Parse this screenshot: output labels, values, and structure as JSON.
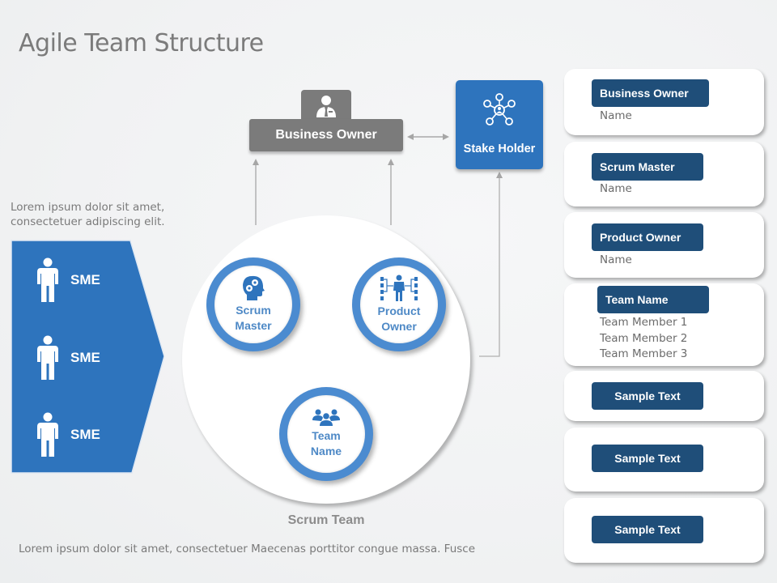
{
  "title": "Agile Team Structure",
  "business_owner": {
    "label": "Business Owner",
    "icon": "businessman-icon"
  },
  "stake_holder": {
    "label": "Stake Holder",
    "icon": "network-people-icon"
  },
  "intro_text": [
    "Lorem ipsum dolor sit amet,",
    "consectetuer adipiscing elit."
  ],
  "sme_panel": {
    "items": [
      {
        "label": "SME",
        "icon": "person-icon"
      },
      {
        "label": "SME",
        "icon": "person-icon"
      },
      {
        "label": "SME",
        "icon": "person-icon"
      }
    ]
  },
  "scrum_team": {
    "label": "Scrum Team",
    "roles": [
      {
        "line1": "Scrum",
        "line2": "Master",
        "icon": "head-gears-icon"
      },
      {
        "line1": "Product",
        "line2": "Owner",
        "icon": "person-connections-icon"
      },
      {
        "line1": "Team",
        "line2": "Name",
        "icon": "group-icon"
      }
    ]
  },
  "footer_text": "Lorem ipsum dolor sit amet, consectetuer Maecenas porttitor congue massa. Fusce",
  "cards": [
    {
      "badge": "Business Owner",
      "lines": [
        "Name"
      ]
    },
    {
      "badge": "Scrum Master",
      "lines": [
        "Name"
      ]
    },
    {
      "badge": "Product Owner",
      "lines": [
        "Name"
      ]
    },
    {
      "badge": "Team Name",
      "lines": [
        "Team Member 1",
        "Team Member 2",
        "Team Member 3"
      ]
    },
    {
      "badge": "Sample Text",
      "lines": []
    },
    {
      "badge": "Sample Text",
      "lines": []
    },
    {
      "badge": "Sample Text",
      "lines": []
    }
  ],
  "colors": {
    "primary_blue": "#2e74bd",
    "dark_navy": "#1f4e79",
    "ring_blue": "#4b8bd0",
    "gray_box": "#7b7b7b",
    "text_gray": "#7a7a7a"
  }
}
